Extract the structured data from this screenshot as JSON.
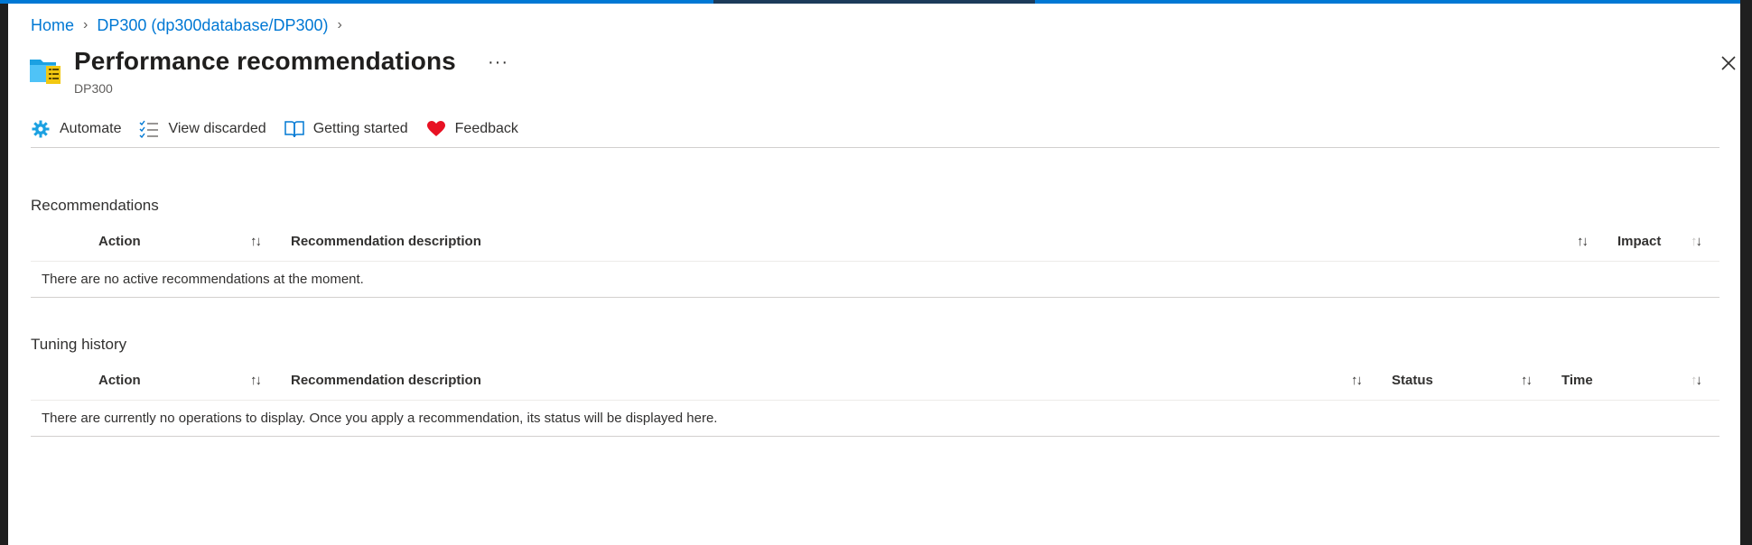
{
  "breadcrumb": {
    "items": [
      "Home",
      "DP300 (dp300database/DP300)"
    ]
  },
  "header": {
    "title": "Performance recommendations",
    "subtitle": "DP300",
    "more": "···"
  },
  "toolbar": {
    "items": [
      {
        "label": "Automate",
        "icon": "gear-icon"
      },
      {
        "label": "View discarded",
        "icon": "checklist-icon"
      },
      {
        "label": "Getting started",
        "icon": "book-icon"
      },
      {
        "label": "Feedback",
        "icon": "heart-icon"
      }
    ]
  },
  "recommendations": {
    "title": "Recommendations",
    "columns": [
      "Action",
      "Recommendation description",
      "Impact"
    ],
    "empty_message": "There are no active recommendations at the moment."
  },
  "tuning_history": {
    "title": "Tuning history",
    "columns": [
      "Action",
      "Recommendation description",
      "Status",
      "Time"
    ],
    "empty_message": "There are currently no operations to display. Once you apply a recommendation, its status will be displayed here."
  },
  "colors": {
    "accent": "#0078d4",
    "feedback_heart": "#e81123",
    "gear": "#1ba1e2"
  }
}
